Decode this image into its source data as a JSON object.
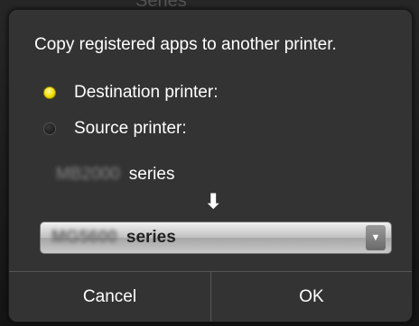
{
  "background": {
    "partial_text": "Series"
  },
  "dialog": {
    "message": "Copy registered apps to another printer.",
    "options": [
      {
        "label": "Destination printer:",
        "selected": true
      },
      {
        "label": "Source printer:",
        "selected": false
      }
    ],
    "source_printer": {
      "model": "MB2000",
      "suffix": "series"
    },
    "arrow": "⬇",
    "dropdown": {
      "model": "MG5600",
      "suffix": "series"
    },
    "buttons": {
      "cancel": "Cancel",
      "ok": "OK"
    }
  },
  "colors": {
    "dialog_bg": "#333333",
    "radio_selected": "#f3df00",
    "text": "#ffffff"
  },
  "icons": {
    "arrow": "down-arrow-icon",
    "dropdown": "dropdown-triangle-icon"
  }
}
